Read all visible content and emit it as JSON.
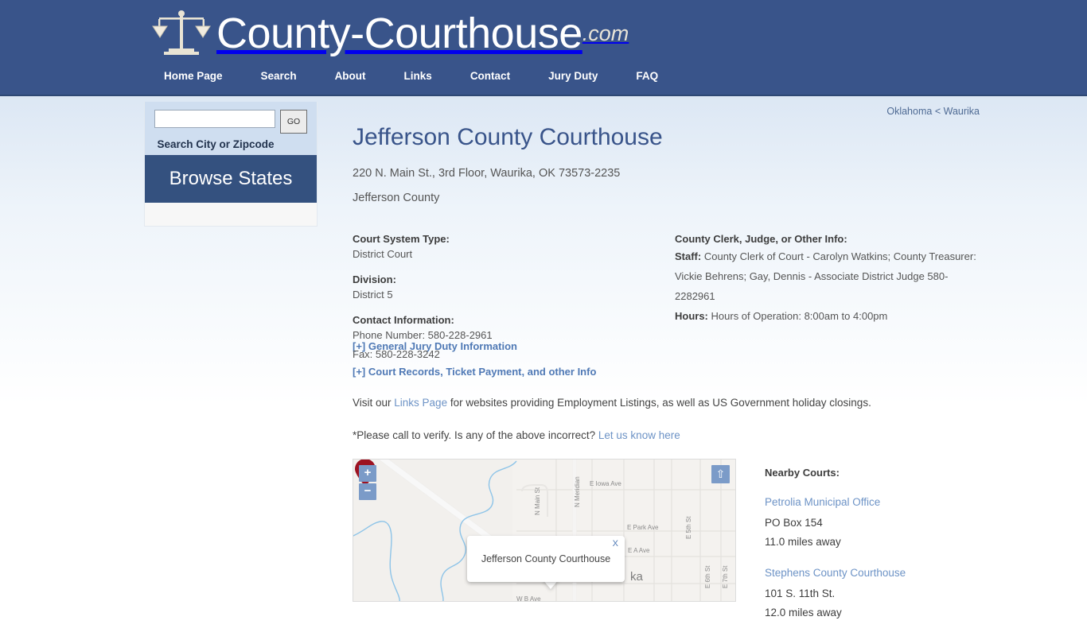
{
  "site": {
    "brand_name": "County-Courthouse",
    "brand_tld": ".com",
    "logo_icon": "scales-of-justice-icon",
    "header_bg": "#39548a",
    "nav": [
      {
        "label": "Home Page"
      },
      {
        "label": "Search"
      },
      {
        "label": "About"
      },
      {
        "label": "Links"
      },
      {
        "label": "Contact"
      },
      {
        "label": "Jury Duty"
      },
      {
        "label": "FAQ"
      }
    ]
  },
  "sidebar": {
    "search_value": "",
    "search_placeholder": "",
    "go_label": "GO",
    "search_caption": "Search City or Zipcode",
    "browse_states_label": "Browse States"
  },
  "breadcrumb": {
    "state": "Oklahoma",
    "separator": "<",
    "city": "Waurika"
  },
  "main": {
    "title": "Jefferson County Courthouse",
    "address": "220 N. Main St., 3rd Floor, Waurika, OK 73573-2235",
    "county": "Jefferson County",
    "court_system_type_label": "Court System Type:",
    "court_system_type_value": "District Court",
    "division_label": "Division:",
    "division_value": "District 5",
    "contact_label": "Contact Information:",
    "phone": "Phone Number: 580-228-2961",
    "fax": "Fax: 580-228-3242",
    "clerk_label": "County Clerk, Judge, or Other Info:",
    "staff_label": "Staff:",
    "staff_value": "County Clerk of Court - Carolyn Watkins; County Treasurer: Vickie Behrens; Gay, Dennis - Associate District Judge 580-2282961",
    "hours_label": "Hours:",
    "hours_value": "Hours of Operation: 8:00am to 4:00pm",
    "expand_jury": "[+] General Jury Duty Information",
    "expand_records": "[+] Court Records, Ticket Payment, and other Info",
    "links_para_pre": "Visit our ",
    "links_para_link": "Links Page",
    "links_para_post": " for websites providing Employment Listings, as well as US Government holiday closings.",
    "verify_para_pre": "*Please call to verify. Is any of the above incorrect? ",
    "verify_para_link": "Let us know here"
  },
  "map": {
    "zoom_in_label": "+",
    "zoom_out_label": "−",
    "fullscreen_icon": "up-arrow-icon",
    "fullscreen_label": "⇧",
    "infowindow_title": "Jefferson County Courthouse",
    "infowindow_close_label": "X",
    "marker_icon": "map-pin-marker",
    "street_labels": [
      "N Meridian",
      "N Main St",
      "E Iowa Ave",
      "E Park Ave",
      "E A Ave",
      "E 6th St",
      "E 7th St",
      "ka"
    ]
  },
  "nearby": {
    "title": "Nearby Courts:",
    "courts": [
      {
        "name": "Petrolia Municipal Office",
        "address": "PO Box 154",
        "distance": "11.0 miles away"
      },
      {
        "name": "Stephens County Courthouse",
        "address": "101 S. 11th St.",
        "distance": "12.0 miles away"
      }
    ]
  }
}
